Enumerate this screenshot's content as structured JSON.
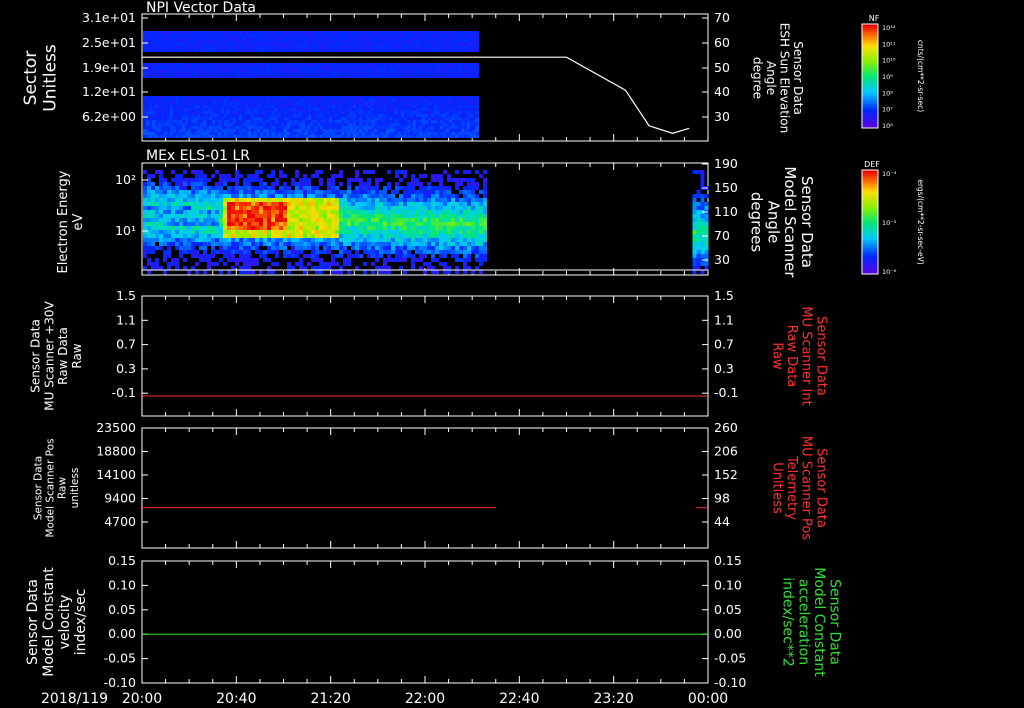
{
  "chart_data": [
    {
      "type": "heatmap",
      "title": "NPI Vector Data",
      "ylabel": "Sector\nUnitless",
      "yticks": [
        "3.1e+01",
        "2.5e+01",
        "1.9e+01",
        "1.2e+01",
        "6.2e+00"
      ],
      "y2label": "Sensor Data\nESH Sun Elevation\nAngle\ndegree",
      "y2ticks": [
        "70",
        "60",
        "50",
        "40",
        "30"
      ],
      "y2lim": [
        20,
        70
      ],
      "colorbar": {
        "label": "NF",
        "unit": "cnts/(cm**2-sr-sec)",
        "ticks": [
          "10¹²",
          "10¹¹",
          "10¹⁰",
          "10⁹",
          "10⁸",
          "10⁷",
          "10⁶"
        ]
      },
      "data_extent": [
        "20:00",
        "22:20"
      ],
      "line": {
        "color": "#ffffff",
        "x": [
          "20:00",
          "22:25",
          "23:00",
          "23:25",
          "23:35",
          "23:45",
          "23:52"
        ],
        "y": [
          53,
          53,
          53,
          40,
          26,
          23,
          25
        ]
      }
    },
    {
      "type": "heatmap",
      "title": "MEx ELS-01 LR",
      "ylabel": "Electron Energy\neV",
      "yticks": [
        "10²",
        "10¹"
      ],
      "y2label": "Sensor Data\nModel Scanner\nAngle\ndegrees",
      "y2ticks": [
        "190",
        "150",
        "110",
        "70",
        "30"
      ],
      "colorbar": {
        "label": "DEF",
        "unit": "ergs/(cm**2-sr-sec-eV)",
        "ticks": [
          "10⁻⁴",
          "10⁻⁵",
          "10⁻⁶"
        ]
      },
      "data_extent": [
        [
          "20:00",
          "22:22"
        ],
        [
          "23:53",
          "24:00"
        ]
      ],
      "intensity_peak": "20:40",
      "line": {
        "color": "#ffffff",
        "y": 20
      }
    },
    {
      "type": "line",
      "ylabel": "Sensor Data\nMU Scanner +30V\nRaw Data\nRaw",
      "yticks": [
        "1.5",
        "1.1",
        "0.7",
        "0.3",
        "-0.1"
      ],
      "ylim": [
        -0.3,
        1.5
      ],
      "y2label": "Sensor Data\nMU Scanner Int\nRaw Data\nRaw",
      "y2ticks": [
        "1.5",
        "1.1",
        "0.7",
        "0.3",
        "-0.1"
      ],
      "series": [
        {
          "color": "#ff3030",
          "x": [
            "20:00",
            "24:00"
          ],
          "y": [
            0.0,
            0.0
          ]
        }
      ]
    },
    {
      "type": "line",
      "ylabel": "Sensor Data\nModel Scanner Pos\nRaw\nunitless",
      "yticks": [
        "23500",
        "18800",
        "14100",
        "9400",
        "4700"
      ],
      "ylim": [
        0,
        23500
      ],
      "y2label": "Sensor Data\nMU Scanner Pos\nTelemetry\nUnitless",
      "y2ticks": [
        "260",
        "206",
        "152",
        "98",
        "44"
      ],
      "series": [
        {
          "color": "#ff3030",
          "x": [
            "20:00",
            "22:30"
          ],
          "y": [
            7900,
            7900
          ]
        },
        {
          "color": "#ff3030",
          "x": [
            "23:55",
            "24:00"
          ],
          "y": [
            7900,
            7900
          ]
        }
      ]
    },
    {
      "type": "line",
      "ylabel": "Sensor Data\nModel Constant\nvelocity\nindex/sec",
      "yticks": [
        "0.15",
        "0.10",
        "0.05",
        "0.00",
        "-0.05",
        "-0.10"
      ],
      "ylim": [
        -0.1,
        0.15
      ],
      "y2label": "Sensor Data\nModel Constant\nacceleration\nindex/sec**2",
      "y2ticks": [
        "0.15",
        "0.10",
        "0.05",
        "0.00",
        "-0.05",
        "-0.10"
      ],
      "series": [
        {
          "color": "#30e030",
          "x": [
            "20:00",
            "24:00"
          ],
          "y": [
            0.0,
            0.0
          ]
        }
      ]
    }
  ],
  "x_axis": {
    "date_label": "2018/119",
    "ticks": [
      "20:00",
      "20:40",
      "21:20",
      "22:00",
      "22:40",
      "23:20",
      "00:00"
    ],
    "xlim": [
      "20:00",
      "24:00"
    ]
  },
  "colors": {
    "label_white": "#ffffff",
    "label_red": "#ff3030",
    "label_green": "#30e030"
  }
}
